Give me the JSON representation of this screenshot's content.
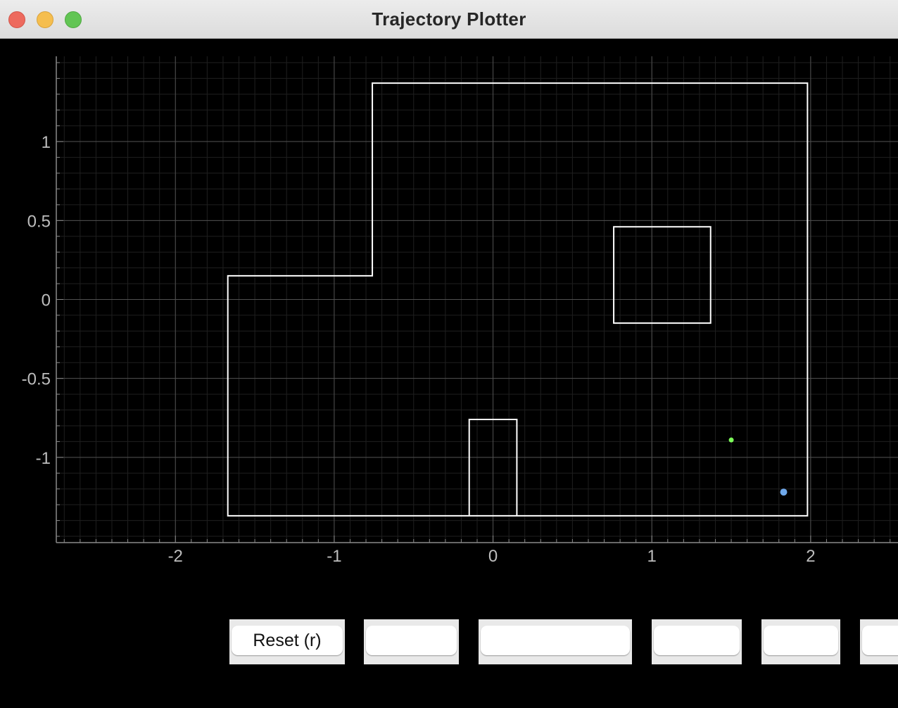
{
  "window": {
    "title": "Trajectory Plotter",
    "controls": [
      "close",
      "minimize",
      "zoom"
    ]
  },
  "colors": {
    "background": "#000000",
    "grid_major": "#505050",
    "grid_minor": "#1f1f1f",
    "axis": "#8a8a8a",
    "walls": "#ffffff",
    "green_point": "#7dff5a",
    "blue_point": "#6fa8ea"
  },
  "buttons": [
    {
      "name": "reset-button",
      "label": "Reset (r)"
    },
    {
      "name": "button-2",
      "label": ""
    },
    {
      "name": "button-3",
      "label": ""
    },
    {
      "name": "button-4",
      "label": ""
    },
    {
      "name": "button-5",
      "label": ""
    },
    {
      "name": "button-6",
      "label": ""
    }
  ],
  "chart_data": {
    "type": "scatter",
    "title": "",
    "xlabel": "",
    "ylabel": "",
    "xlim": [
      -2.75,
      2.55
    ],
    "ylim": [
      -1.54,
      1.54
    ],
    "xticks": [
      -2,
      -1,
      0,
      1,
      2
    ],
    "yticks": [
      1,
      0.5,
      0,
      -0.5,
      -1
    ],
    "grid": true,
    "minor_grid": true,
    "walls": [
      {
        "name": "outer-boundary",
        "points": [
          [
            -1.67,
            -1.37
          ],
          [
            -1.67,
            0.15
          ],
          [
            -0.76,
            0.15
          ],
          [
            -0.76,
            1.37
          ],
          [
            1.98,
            1.37
          ],
          [
            1.98,
            -1.37
          ]
        ],
        "closed": true
      },
      {
        "name": "square-obstacle",
        "points": [
          [
            0.76,
            -0.15
          ],
          [
            0.76,
            0.46
          ],
          [
            1.37,
            0.46
          ],
          [
            1.37,
            -0.15
          ]
        ],
        "closed": true
      },
      {
        "name": "bottom-obstacle",
        "points": [
          [
            -0.15,
            -1.37
          ],
          [
            -0.15,
            -0.76
          ],
          [
            0.15,
            -0.76
          ],
          [
            0.15,
            -1.37
          ]
        ],
        "closed": false
      }
    ],
    "points": [
      {
        "name": "green-point",
        "x": 1.5,
        "y": -0.89,
        "color": "#7dff5a"
      },
      {
        "name": "blue-point",
        "x": 1.83,
        "y": -1.22,
        "color": "#6fa8ea"
      }
    ]
  }
}
